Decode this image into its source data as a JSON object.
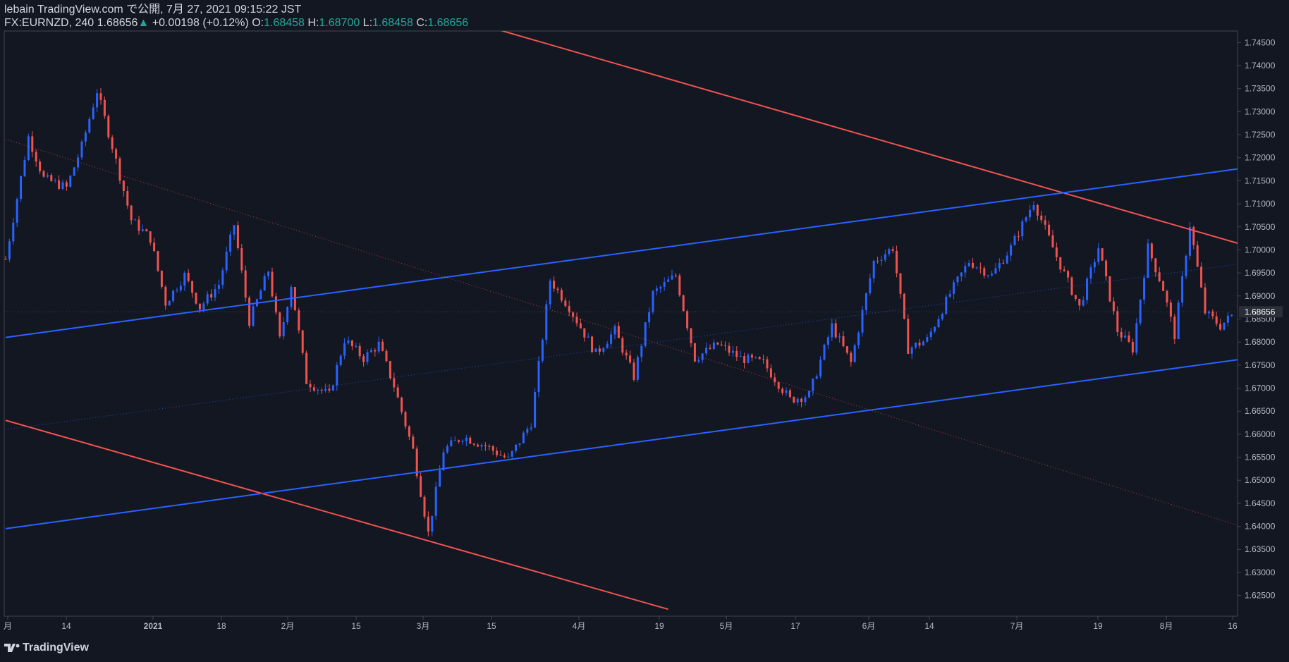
{
  "header": {
    "published": "lebain TradingView.com で公開, 7月 27, 2021 09:15:22 JST",
    "symbol_tf": "FX:EURNZD, 240",
    "last": "1.68656",
    "arrow": "▲",
    "change": "+0.00198 (+0.12%)",
    "o_label": "O:",
    "o": "1.68458",
    "h_label": "H:",
    "h": "1.68700",
    "l_label": "L:",
    "l": "1.68458",
    "c_label": "C:",
    "c": "1.68656"
  },
  "footer": {
    "brand": "TradingView"
  },
  "colors": {
    "background": "#131722",
    "up": "#2962ff",
    "down": "#ef5350",
    "resistance": "#ef5350",
    "channel": "#2962ff",
    "axis_text": "#b2b5be"
  },
  "chart_data": {
    "type": "candlestick",
    "title": "FX:EURNZD, 240",
    "ylim": [
      1.6205,
      1.7475
    ],
    "y_ticks": [
      "1.74500",
      "1.74000",
      "1.73500",
      "1.73000",
      "1.72500",
      "1.72000",
      "1.71500",
      "1.71000",
      "1.70500",
      "1.70000",
      "1.69500",
      "1.69000",
      "1.68500",
      "1.68000",
      "1.67500",
      "1.67000",
      "1.66500",
      "1.66000",
      "1.65500",
      "1.65000",
      "1.64500",
      "1.64000",
      "1.63500",
      "1.63000",
      "1.62500"
    ],
    "x_ticks": [
      "月",
      "14",
      "2021",
      "18",
      "2月",
      "15",
      "3月",
      "15",
      "4月",
      "19",
      "5月",
      "17",
      "6月",
      "14",
      "7月",
      "19",
      "8月",
      "16"
    ],
    "last_price": "1.68656",
    "price_path": [
      [
        0,
        1.698
      ],
      [
        6,
        1.7245
      ],
      [
        10,
        1.7155
      ],
      [
        16,
        1.7135
      ],
      [
        20,
        1.7225
      ],
      [
        24,
        1.7345
      ],
      [
        28,
        1.7225
      ],
      [
        33,
        1.7065
      ],
      [
        38,
        1.7025
      ],
      [
        42,
        1.6885
      ],
      [
        47,
        1.6945
      ],
      [
        51,
        1.6875
      ],
      [
        56,
        1.6925
      ],
      [
        60,
        1.7055
      ],
      [
        64,
        1.6845
      ],
      [
        69,
        1.6955
      ],
      [
        72,
        1.6805
      ],
      [
        75,
        1.6925
      ],
      [
        79,
        1.6715
      ],
      [
        85,
        1.6685
      ],
      [
        89,
        1.6805
      ],
      [
        94,
        1.6765
      ],
      [
        98,
        1.6795
      ],
      [
        102,
        1.6705
      ],
      [
        107,
        1.6565
      ],
      [
        111,
        1.6385
      ],
      [
        115,
        1.6565
      ],
      [
        120,
        1.6595
      ],
      [
        126,
        1.6575
      ],
      [
        132,
        1.6545
      ],
      [
        138,
        1.6625
      ],
      [
        143,
        1.6935
      ],
      [
        148,
        1.6875
      ],
      [
        155,
        1.6775
      ],
      [
        160,
        1.6825
      ],
      [
        165,
        1.6725
      ],
      [
        170,
        1.6905
      ],
      [
        176,
        1.6945
      ],
      [
        181,
        1.6765
      ],
      [
        187,
        1.6795
      ],
      [
        193,
        1.6765
      ],
      [
        199,
        1.6755
      ],
      [
        206,
        1.6675
      ],
      [
        211,
        1.6685
      ],
      [
        217,
        1.6835
      ],
      [
        222,
        1.6755
      ],
      [
        228,
        1.6975
      ],
      [
        233,
        1.7005
      ],
      [
        237,
        1.6785
      ],
      [
        242,
        1.6805
      ],
      [
        248,
        1.6905
      ],
      [
        253,
        1.6975
      ],
      [
        259,
        1.6945
      ],
      [
        264,
        1.7005
      ],
      [
        270,
        1.7105
      ],
      [
        276,
        1.6985
      ],
      [
        282,
        1.6875
      ],
      [
        287,
        1.7005
      ],
      [
        292,
        1.6825
      ],
      [
        296,
        1.6785
      ],
      [
        300,
        1.7005
      ],
      [
        304,
        1.6915
      ],
      [
        307,
        1.6815
      ],
      [
        311,
        1.7055
      ],
      [
        315,
        1.6865
      ],
      [
        319,
        1.6835
      ],
      [
        323,
        1.6865
      ]
    ],
    "trendlines": [
      {
        "name": "upper-red",
        "color": "#ef5350",
        "x1": -20.3,
        "y1": 1.7835,
        "x2": 338,
        "y2": 1.698
      },
      {
        "name": "lower-red",
        "color": "#ef5350",
        "x1": 0,
        "y1": 1.663,
        "x2": 174,
        "y2": 1.622
      },
      {
        "name": "channel-top",
        "color": "#2962ff",
        "x1": 0,
        "y1": 1.681,
        "x2": 338,
        "y2": 1.7192
      },
      {
        "name": "channel-bottom",
        "color": "#2962ff",
        "x1": 0,
        "y1": 1.6395,
        "x2": 338,
        "y2": 1.6778
      },
      {
        "name": "mid-red-dotted",
        "color": "#ef5350",
        "x1": 0,
        "y1": 1.724,
        "x2": 338,
        "y2": 1.6365
      },
      {
        "name": "mid-blue-dotted",
        "color": "#2962ff",
        "x1": 0,
        "y1": 1.661,
        "x2": 338,
        "y2": 1.6985
      }
    ]
  }
}
